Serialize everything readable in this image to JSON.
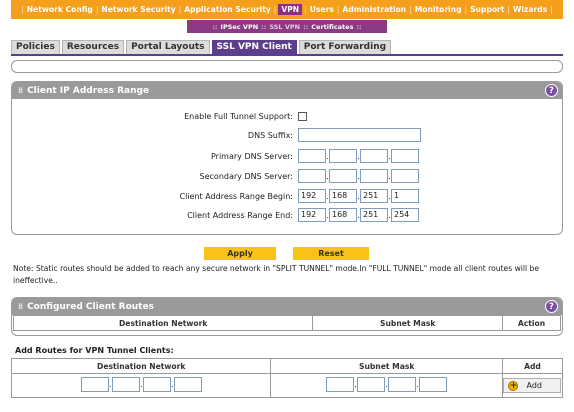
{
  "top_nav": [
    "Network Config",
    "Network Security",
    "Application Security",
    "VPN",
    "Users",
    "Administration",
    "Monitoring",
    "Support",
    "Wizards"
  ],
  "top_nav_active": "VPN",
  "sub_nav": {
    "items": [
      "IPSec VPN",
      "SSL VPN",
      "Certificates"
    ],
    "current": "SSL VPN"
  },
  "tabs": [
    "Policies",
    "Resources",
    "Portal Layouts",
    "SSL VPN Client",
    "Port Forwarding"
  ],
  "tabs_active": "SSL VPN Client",
  "client_ip_section": {
    "title": "Client IP Address Range",
    "full_tunnel_label": "Enable Full Tunnel Support:",
    "full_tunnel_checked": false,
    "dns_suffix_label": "DNS Suffix:",
    "dns_suffix_value": "",
    "primary_dns_label": "Primary DNS Server:",
    "primary_dns": [
      "",
      "",
      "",
      ""
    ],
    "secondary_dns_label": "Secondary DNS Server:",
    "secondary_dns": [
      "",
      "",
      "",
      ""
    ],
    "range_begin_label": "Client Address Range Begin:",
    "range_begin": [
      "192",
      "168",
      "251",
      "1"
    ],
    "range_end_label": "Client Address Range End:",
    "range_end": [
      "192",
      "168",
      "251",
      "254"
    ]
  },
  "buttons": {
    "apply": "Apply",
    "reset": "Reset"
  },
  "note": "Note: Static routes should be added to reach any secure network in \"SPLIT TUNNEL\" mode.In \"FULL TUNNEL\" mode all client routes will be ineffective..",
  "routes_section": {
    "title": "Configured Client Routes",
    "columns": [
      "Destination Network",
      "Subnet Mask",
      "Action"
    ]
  },
  "add_routes": {
    "title": "Add Routes for VPN Tunnel Clients:",
    "columns": [
      "Destination Network",
      "Subnet Mask",
      "Add"
    ],
    "add_button": "Add"
  },
  "colors": {
    "nav_orange": "#f59f1c",
    "vpn_purple": "#8b2f86",
    "tab_active": "#5b3f8c",
    "button_yellow": "#f9c216",
    "header_gray": "#9a9a9a"
  }
}
